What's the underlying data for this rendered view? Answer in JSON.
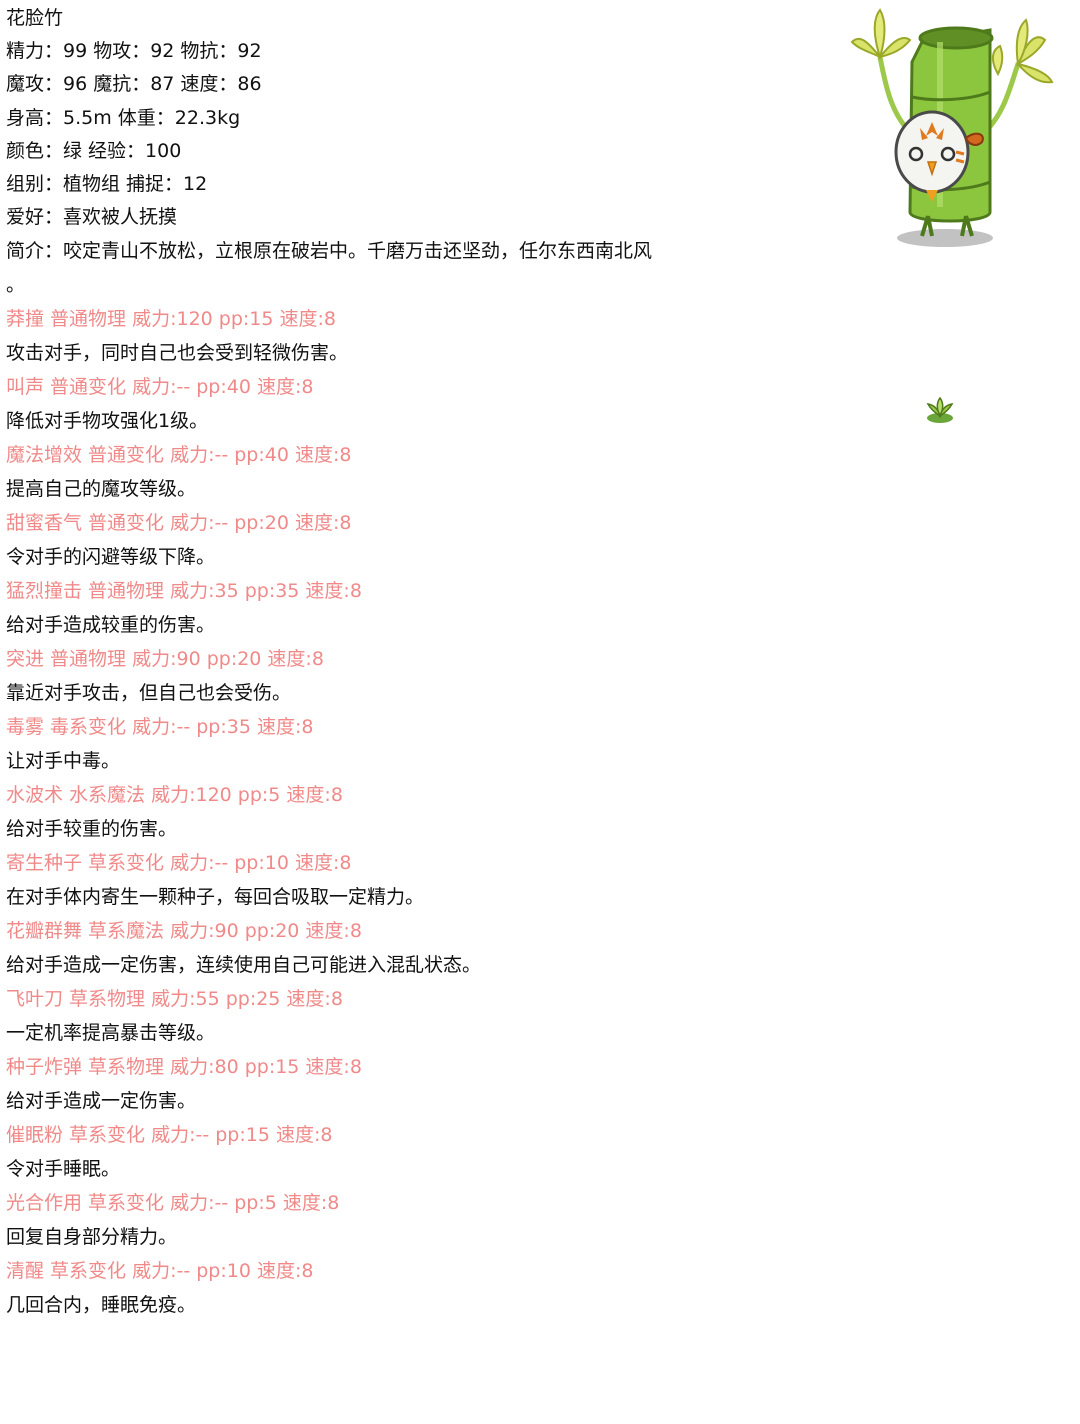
{
  "pet": {
    "name": "花脸竹",
    "stats_line1": "精力：99 物攻：92 物抗：92",
    "stats_line2": "魔攻：96 魔抗：87 速度：86",
    "stats_line3": "身高：5.5m 体重：22.3kg",
    "stats_line4": "颜色：绿 经验：100",
    "stats_line5": "组别：植物组 捕捉：12",
    "hobby": "爱好：喜欢被人抚摸",
    "intro": "简介：咬定青山不放松，立根原在破岩中。千磨万击还坚劲，任尔东西南北风",
    "intro_tail": "。"
  },
  "skills": [
    {
      "header": "莽撞 普通物理 威力:120 pp:15 速度:8",
      "desc": "攻击对手，同时自己也会受到轻微伤害。"
    },
    {
      "header": "叫声 普通变化 威力:-- pp:40 速度:8",
      "desc": "降低对手物攻强化1级。"
    },
    {
      "header": "魔法增效 普通变化 威力:-- pp:40 速度:8",
      "desc": "提高自己的魔攻等级。"
    },
    {
      "header": "甜蜜香气 普通变化 威力:-- pp:20 速度:8",
      "desc": "令对手的闪避等级下降。"
    },
    {
      "header": "猛烈撞击 普通物理 威力:35 pp:35 速度:8",
      "desc": "给对手造成较重的伤害。"
    },
    {
      "header": "突进 普通物理 威力:90 pp:20 速度:8",
      "desc": "靠近对手攻击，但自己也会受伤。"
    },
    {
      "header": "毒雾 毒系变化 威力:-- pp:35 速度:8",
      "desc": "让对手中毒。"
    },
    {
      "header": "水波术 水系魔法 威力:120 pp:5 速度:8",
      "desc": "给对手较重的伤害。"
    },
    {
      "header": "寄生种子 草系变化 威力:-- pp:10 速度:8",
      "desc": "在对手体内寄生一颗种子，每回合吸取一定精力。"
    },
    {
      "header": "花瓣群舞 草系魔法 威力:90 pp:20 速度:8",
      "desc": "给对手造成一定伤害，连续使用自己可能进入混乱状态。"
    },
    {
      "header": "飞叶刀 草系物理 威力:55 pp:25 速度:8",
      "desc": "一定机率提高暴击等级。"
    },
    {
      "header": "种子炸弹 草系物理 威力:80 pp:15 速度:8",
      "desc": "给对手造成一定伤害。"
    },
    {
      "header": "催眠粉 草系变化 威力:-- pp:15 速度:8",
      "desc": "令对手睡眠。"
    },
    {
      "header": "光合作用 草系变化 威力:-- pp:5 速度:8",
      "desc": "回复自身部分精力。"
    },
    {
      "header": "清醒 草系变化 威力:-- pp:10 速度:8",
      "desc": "几回合内，睡眠免疫。"
    }
  ],
  "colors": {
    "skill_header": "#f08a8a",
    "text": "#111111",
    "bamboo_green": "#8cc63f"
  },
  "icons": {
    "mascot": "bamboo-mascot-icon",
    "sprout": "sprout-icon"
  }
}
